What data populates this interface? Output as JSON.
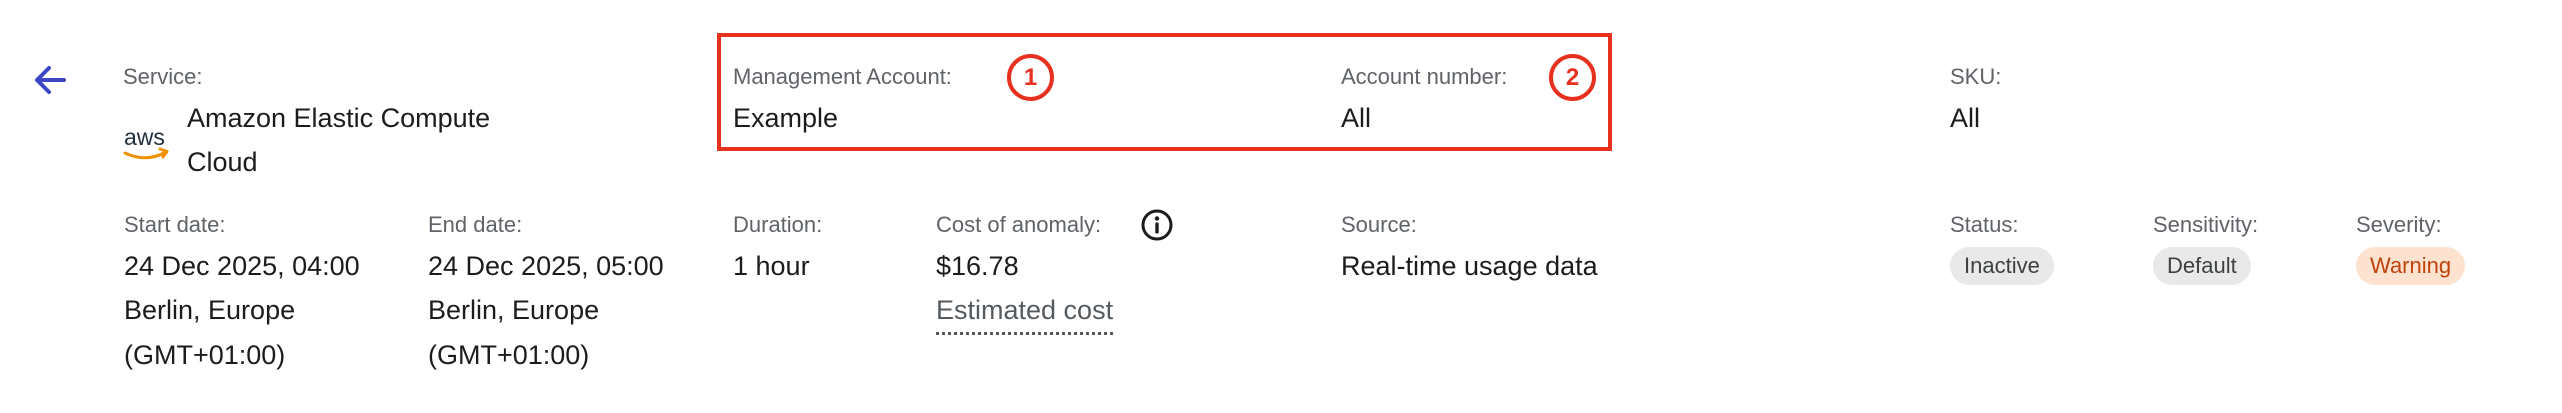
{
  "colors": {
    "highlight": "#e8301e",
    "back_arrow": "#3c46c8",
    "aws_orange": "#f29100",
    "warning_bg": "#fde2cf",
    "warning_text": "#c1420b",
    "neutral_badge_bg": "#e9e9e9"
  },
  "icons": {
    "back": "arrow-left-icon",
    "aws": "aws-logo-icon",
    "info": "info-icon"
  },
  "service": {
    "label": "Service:",
    "logo_text": "aws",
    "value": "Amazon Elastic Compute Cloud"
  },
  "management_account": {
    "label": "Management Account:",
    "value": "Example",
    "marker": "1"
  },
  "account_number": {
    "label": "Account number:",
    "value": "All",
    "marker": "2"
  },
  "sku": {
    "label": "SKU:",
    "value": "All"
  },
  "start_date": {
    "label": "Start date:",
    "lines": [
      "24 Dec 2025, 04:00",
      "Berlin, Europe",
      "(GMT+01:00)"
    ]
  },
  "end_date": {
    "label": "End date:",
    "lines": [
      "24 Dec 2025, 05:00",
      "Berlin, Europe",
      "(GMT+01:00)"
    ]
  },
  "duration": {
    "label": "Duration:",
    "value": "1 hour"
  },
  "cost_of_anomaly": {
    "label": "Cost of anomaly:",
    "value": "$16.78",
    "link": "Estimated cost"
  },
  "source": {
    "label": "Source:",
    "value": "Real-time usage data"
  },
  "status": {
    "label": "Status:",
    "value": "Inactive"
  },
  "sensitivity": {
    "label": "Sensitivity:",
    "value": "Default"
  },
  "severity": {
    "label": "Severity:",
    "value": "Warning"
  }
}
